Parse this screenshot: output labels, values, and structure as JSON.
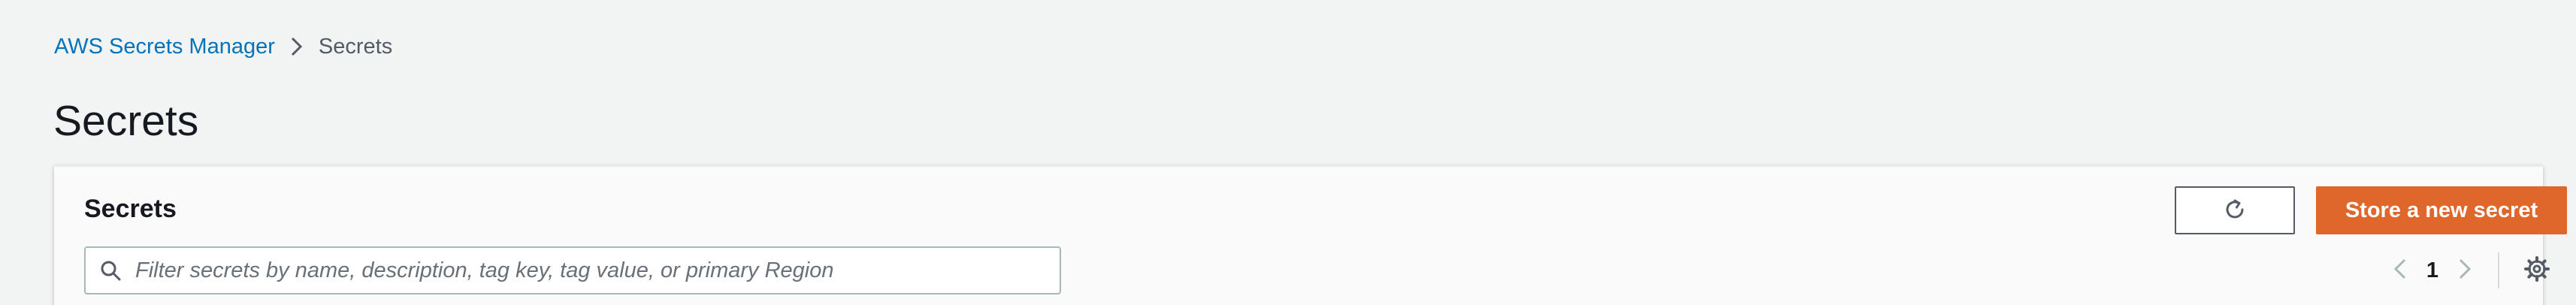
{
  "breadcrumb": {
    "service_label": "AWS Secrets Manager",
    "current_label": "Secrets"
  },
  "page": {
    "title": "Secrets"
  },
  "secrets_panel": {
    "title": "Secrets",
    "search": {
      "placeholder": "Filter secrets by name, description, tag key, tag value, or primary Region",
      "value": ""
    },
    "store_button_label": "Store a new secret",
    "pagination": {
      "current_page": "1"
    }
  },
  "icons": {
    "breadcrumb_separator": "chevron-right-icon",
    "search": "search-icon",
    "refresh": "refresh-icon",
    "previous": "chevron-left-icon",
    "next": "chevron-right-icon",
    "settings": "gear-icon"
  },
  "colors": {
    "primary_button": "#e0672b",
    "link": "#0073bb",
    "background": "#f2f3f3"
  }
}
